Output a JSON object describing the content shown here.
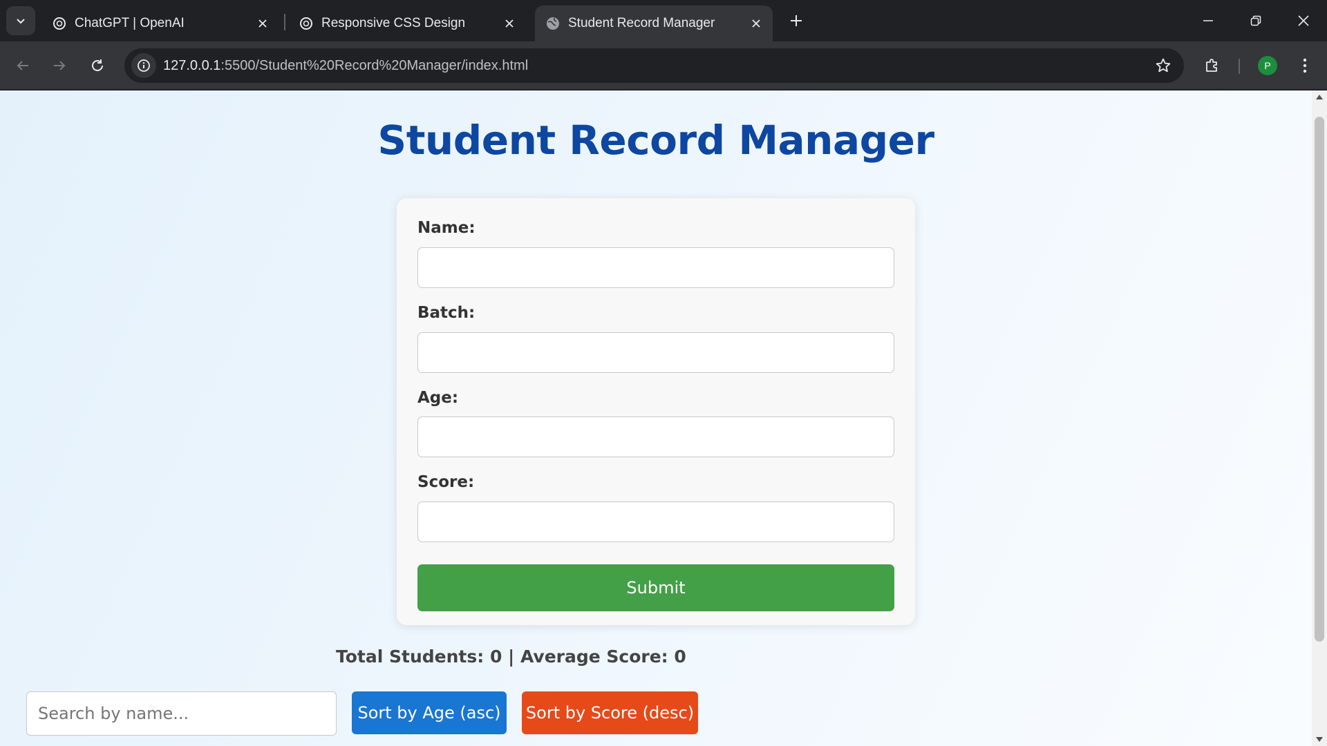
{
  "browser": {
    "tabs": [
      {
        "title": "ChatGPT | OpenAI",
        "icon": "openai-icon",
        "active": false
      },
      {
        "title": "Responsive CSS Design",
        "icon": "openai-icon",
        "active": false
      },
      {
        "title": "Student Record Manager",
        "icon": "globe-icon",
        "active": true
      }
    ],
    "url_host": "127.0.0.1",
    "url_path": ":5500/Student%20Record%20Manager/index.html",
    "profile_initial": "P",
    "colors": {
      "profile": "#1e8e3e",
      "chrome_dark": "#202124",
      "chrome_tab": "#35363a"
    }
  },
  "page": {
    "title": "Student Record Manager",
    "form": {
      "name_label": "Name:",
      "batch_label": "Batch:",
      "age_label": "Age:",
      "score_label": "Score:",
      "name_value": "",
      "batch_value": "",
      "age_value": "",
      "score_value": "",
      "submit_label": "Submit"
    },
    "stats": {
      "total_label": "Total Students:",
      "total_value": "0",
      "separator": "|",
      "average_label": "Average Score:",
      "average_value": "0"
    },
    "search": {
      "placeholder": "Search by name...",
      "value": ""
    },
    "sort_age_label": "Sort by Age (asc)",
    "sort_score_label": "Sort by Score (desc)",
    "colors": {
      "title": "#0d47a1",
      "submit": "#43a047",
      "sort_age": "#1976d2",
      "sort_score": "#e64a19"
    }
  }
}
